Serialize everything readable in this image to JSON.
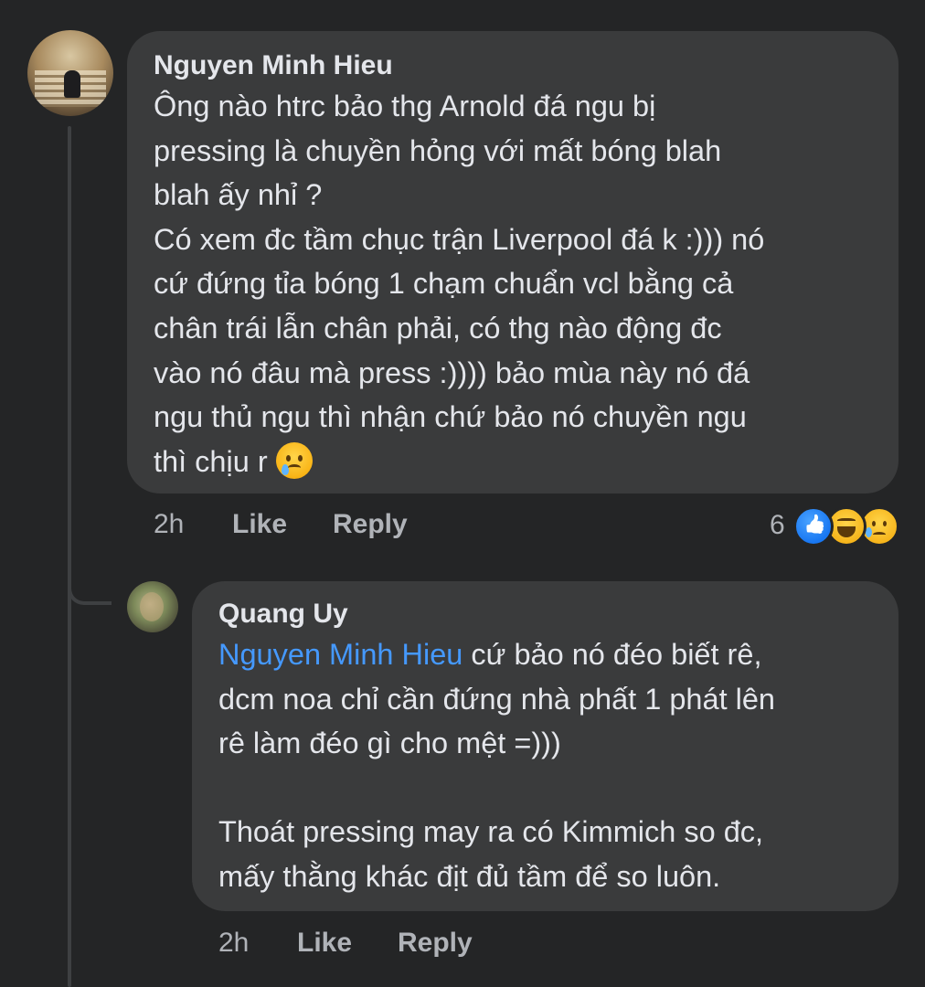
{
  "comment": {
    "author": "Nguyen Minh Hieu",
    "lines": [
      "Ông nào htrc bảo thg Arnold đá ngu bị",
      "pressing là chuyền hỏng với mất bóng blah",
      "blah ấy nhỉ ?",
      "Có xem đc tầm chục trận Liverpool đá k :))) nó",
      "cứ đứng tỉa bóng 1 chạm chuẩn vcl bằng cả",
      "chân trái lẫn chân phải, có thg nào động đc",
      "vào nó đâu mà press :)))) bảo mùa này nó đá",
      "ngu thủ ngu thì nhận chứ bảo nó chuyền ngu",
      "thì chịu r"
    ],
    "trailing_emoji": "sad-tear-emoji",
    "time": "2h",
    "like_label": "Like",
    "reply_label": "Reply",
    "reaction_count": "6",
    "reactions": [
      "like-reaction",
      "haha-reaction",
      "sad-reaction"
    ]
  },
  "reply": {
    "author": "Quang Uy",
    "mention": "Nguyen Minh Hieu",
    "first_line_rest": " cứ bảo nó đéo biết rê,",
    "lines": [
      "dcm noa chỉ cần đứng nhà phất 1 phát lên",
      "rê làm đéo gì cho mệt =)))",
      "",
      "Thoát pressing may ra có Kimmich so đc,",
      "mấy thằng khác địt đủ tầm để so luôn."
    ],
    "time": "2h",
    "like_label": "Like",
    "reply_label": "Reply"
  },
  "colors": {
    "background": "#242526",
    "bubble": "#3a3b3c",
    "text": "#e4e6eb",
    "secondary_text": "#b0b3b8",
    "mention": "#4599ff"
  }
}
